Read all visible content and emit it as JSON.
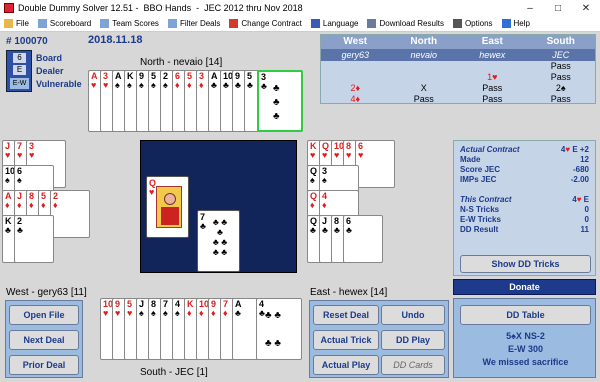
{
  "window": {
    "title": "Double Dummy Solver 12.51 -  BBO Hands  -  JEC 2012 thru Nov 2018",
    "controls": [
      "–",
      "□",
      "✕"
    ]
  },
  "menu": [
    {
      "label": "File",
      "icon": "folder-icon",
      "color": "#e8b64a"
    },
    {
      "label": "Scoreboard",
      "icon": "scoreboard-icon",
      "color": "#7fa3d6"
    },
    {
      "label": "Team Scores",
      "icon": "team-scores-icon",
      "color": "#7fa3d6"
    },
    {
      "label": "Filter Deals",
      "icon": "filter-icon",
      "color": "#7fa3d6"
    },
    {
      "label": "Change Contract",
      "icon": "change-contract-icon",
      "color": "#d23a2a"
    },
    {
      "label": "Language",
      "icon": "flag-icon",
      "color": "#3a5bb5"
    },
    {
      "label": "Download Results",
      "icon": "download-icon",
      "color": "#6a7a9a"
    },
    {
      "label": "Options",
      "icon": "gear-icon",
      "color": "#555555"
    },
    {
      "label": "Help",
      "icon": "help-icon",
      "color": "#2f6fd6"
    }
  ],
  "board": {
    "number": "# 100070",
    "date": "2018.11.18",
    "num_box": "6",
    "dealer_box": "E",
    "vul_box": "E-W",
    "labels": {
      "board": "Board",
      "dealer": "Dealer",
      "vulnerable": "Vulnerable"
    }
  },
  "players": {
    "north": "North - nevaio  [14]",
    "west": "West - gery63  [11]",
    "east": "East - hewex  [14]",
    "south": "South - JEC  [1]"
  },
  "auction": {
    "headers": [
      "West",
      "North",
      "East",
      "South"
    ],
    "names": [
      "gery63",
      "nevaio",
      "hewex",
      "JEC"
    ],
    "rows": [
      [
        "",
        "",
        "",
        "Pass"
      ],
      [
        "",
        "",
        "1♥",
        "Pass"
      ],
      [
        "2♦",
        "X",
        "Pass",
        "2♠"
      ],
      [
        "4♦",
        "Pass",
        "Pass",
        "Pass"
      ]
    ]
  },
  "cards": {
    "north": [
      {
        "r": "A",
        "s": "♥"
      },
      {
        "r": "3",
        "s": "♥"
      },
      {
        "r": "A",
        "s": "♠"
      },
      {
        "r": "K",
        "s": "♠"
      },
      {
        "r": "9",
        "s": "♠"
      },
      {
        "r": "5",
        "s": "♠"
      },
      {
        "r": "2",
        "s": "♠"
      },
      {
        "r": "6",
        "s": "♦"
      },
      {
        "r": "5",
        "s": "♦"
      },
      {
        "r": "3",
        "s": "♦"
      },
      {
        "r": "A",
        "s": "♣"
      },
      {
        "r": "10",
        "s": "♣"
      },
      {
        "r": "9",
        "s": "♣"
      },
      {
        "r": "5",
        "s": "♣"
      }
    ],
    "north_last": {
      "r": "3",
      "s": "♣"
    },
    "west_rows": [
      [
        {
          "r": "J",
          "s": "♥"
        },
        {
          "r": "7",
          "s": "♥"
        },
        {
          "r": "3",
          "s": "♥"
        }
      ],
      [
        {
          "r": "10",
          "s": "♠"
        },
        {
          "r": "6",
          "s": "♠"
        }
      ],
      [
        {
          "r": "A",
          "s": "♦"
        },
        {
          "r": "J",
          "s": "♦"
        },
        {
          "r": "8",
          "s": "♦"
        },
        {
          "r": "5",
          "s": "♦"
        },
        {
          "r": "2",
          "s": "♦"
        }
      ],
      [
        {
          "r": "K",
          "s": "♣"
        },
        {
          "r": "2",
          "s": "♣"
        }
      ]
    ],
    "east_rows": [
      [
        {
          "r": "K",
          "s": "♥"
        },
        {
          "r": "Q",
          "s": "♥"
        },
        {
          "r": "10",
          "s": "♥"
        },
        {
          "r": "8",
          "s": "♥"
        },
        {
          "r": "6",
          "s": "♥"
        }
      ],
      [
        {
          "r": "Q",
          "s": "♠"
        },
        {
          "r": "3",
          "s": "♠"
        }
      ],
      [
        {
          "r": "Q",
          "s": "♦"
        },
        {
          "r": "4",
          "s": "♦"
        }
      ],
      [
        {
          "r": "Q",
          "s": "♣"
        },
        {
          "r": "J",
          "s": "♣"
        },
        {
          "r": "8",
          "s": "♣"
        },
        {
          "r": "6",
          "s": "♣"
        }
      ]
    ],
    "south": [
      {
        "r": "10",
        "s": "♥"
      },
      {
        "r": "9",
        "s": "♥"
      },
      {
        "r": "5",
        "s": "♥"
      },
      {
        "r": "J",
        "s": "♠"
      },
      {
        "r": "8",
        "s": "♠"
      },
      {
        "r": "7",
        "s": "♠"
      },
      {
        "r": "4",
        "s": "♠"
      },
      {
        "r": "K",
        "s": "♦"
      },
      {
        "r": "10",
        "s": "♦"
      },
      {
        "r": "9",
        "s": "♦"
      },
      {
        "r": "7",
        "s": "♦"
      },
      {
        "r": "A",
        "s": "♣"
      }
    ],
    "south_last": {
      "r": "4",
      "s": "♣"
    },
    "played_west": {
      "r": "Q",
      "s": "♥"
    },
    "played_south": {
      "r": "7",
      "s": "♣"
    }
  },
  "contract_panel": {
    "rows": [
      {
        "label": "Actual Contract",
        "value": "4♥ E +2"
      },
      {
        "label": "Made",
        "value": "12"
      },
      {
        "label": "Score JEC",
        "value": "-680"
      },
      {
        "label": "IMPs JEC",
        "value": "-2.00"
      },
      {
        "label": "",
        "value": ""
      },
      {
        "label": "This Contract",
        "value": "4♥ E"
      },
      {
        "label": "N-S Tricks",
        "value": "0"
      },
      {
        "label": "E-W Tricks",
        "value": "0"
      },
      {
        "label": "DD Result",
        "value": "11"
      }
    ],
    "show_dd": "Show DD Tricks"
  },
  "donate": "Donate",
  "buttons": {
    "open_file": "Open File",
    "next_deal": "Next Deal",
    "prior_deal": "Prior Deal",
    "reset_deal": "Reset Deal",
    "undo": "Undo",
    "actual_trick": "Actual Trick",
    "dd_play": "DD Play",
    "actual_play": "Actual Play",
    "dd_cards": "DD Cards",
    "dd_table": "DD Table"
  },
  "dd_summary": {
    "line1": "5♠X NS-2",
    "line2": "E-W   300",
    "line3": "We missed sacrifice"
  }
}
